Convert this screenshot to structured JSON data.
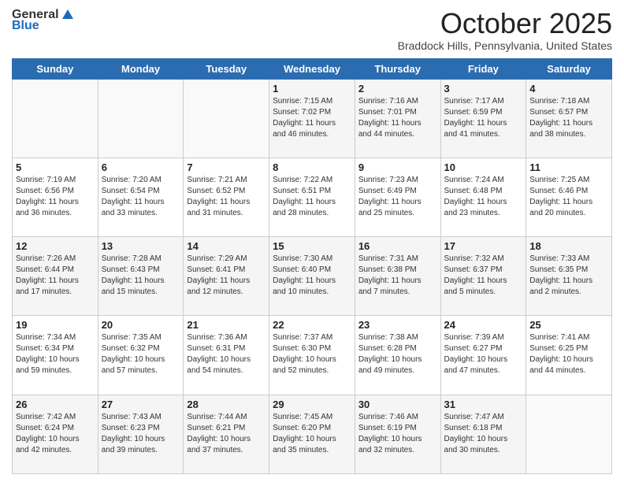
{
  "header": {
    "logo_general": "General",
    "logo_blue": "Blue",
    "month": "October 2025",
    "location": "Braddock Hills, Pennsylvania, United States"
  },
  "days_of_week": [
    "Sunday",
    "Monday",
    "Tuesday",
    "Wednesday",
    "Thursday",
    "Friday",
    "Saturday"
  ],
  "weeks": [
    [
      {
        "day": "",
        "info": ""
      },
      {
        "day": "",
        "info": ""
      },
      {
        "day": "",
        "info": ""
      },
      {
        "day": "1",
        "info": "Sunrise: 7:15 AM\nSunset: 7:02 PM\nDaylight: 11 hours\nand 46 minutes."
      },
      {
        "day": "2",
        "info": "Sunrise: 7:16 AM\nSunset: 7:01 PM\nDaylight: 11 hours\nand 44 minutes."
      },
      {
        "day": "3",
        "info": "Sunrise: 7:17 AM\nSunset: 6:59 PM\nDaylight: 11 hours\nand 41 minutes."
      },
      {
        "day": "4",
        "info": "Sunrise: 7:18 AM\nSunset: 6:57 PM\nDaylight: 11 hours\nand 38 minutes."
      }
    ],
    [
      {
        "day": "5",
        "info": "Sunrise: 7:19 AM\nSunset: 6:56 PM\nDaylight: 11 hours\nand 36 minutes."
      },
      {
        "day": "6",
        "info": "Sunrise: 7:20 AM\nSunset: 6:54 PM\nDaylight: 11 hours\nand 33 minutes."
      },
      {
        "day": "7",
        "info": "Sunrise: 7:21 AM\nSunset: 6:52 PM\nDaylight: 11 hours\nand 31 minutes."
      },
      {
        "day": "8",
        "info": "Sunrise: 7:22 AM\nSunset: 6:51 PM\nDaylight: 11 hours\nand 28 minutes."
      },
      {
        "day": "9",
        "info": "Sunrise: 7:23 AM\nSunset: 6:49 PM\nDaylight: 11 hours\nand 25 minutes."
      },
      {
        "day": "10",
        "info": "Sunrise: 7:24 AM\nSunset: 6:48 PM\nDaylight: 11 hours\nand 23 minutes."
      },
      {
        "day": "11",
        "info": "Sunrise: 7:25 AM\nSunset: 6:46 PM\nDaylight: 11 hours\nand 20 minutes."
      }
    ],
    [
      {
        "day": "12",
        "info": "Sunrise: 7:26 AM\nSunset: 6:44 PM\nDaylight: 11 hours\nand 17 minutes."
      },
      {
        "day": "13",
        "info": "Sunrise: 7:28 AM\nSunset: 6:43 PM\nDaylight: 11 hours\nand 15 minutes."
      },
      {
        "day": "14",
        "info": "Sunrise: 7:29 AM\nSunset: 6:41 PM\nDaylight: 11 hours\nand 12 minutes."
      },
      {
        "day": "15",
        "info": "Sunrise: 7:30 AM\nSunset: 6:40 PM\nDaylight: 11 hours\nand 10 minutes."
      },
      {
        "day": "16",
        "info": "Sunrise: 7:31 AM\nSunset: 6:38 PM\nDaylight: 11 hours\nand 7 minutes."
      },
      {
        "day": "17",
        "info": "Sunrise: 7:32 AM\nSunset: 6:37 PM\nDaylight: 11 hours\nand 5 minutes."
      },
      {
        "day": "18",
        "info": "Sunrise: 7:33 AM\nSunset: 6:35 PM\nDaylight: 11 hours\nand 2 minutes."
      }
    ],
    [
      {
        "day": "19",
        "info": "Sunrise: 7:34 AM\nSunset: 6:34 PM\nDaylight: 10 hours\nand 59 minutes."
      },
      {
        "day": "20",
        "info": "Sunrise: 7:35 AM\nSunset: 6:32 PM\nDaylight: 10 hours\nand 57 minutes."
      },
      {
        "day": "21",
        "info": "Sunrise: 7:36 AM\nSunset: 6:31 PM\nDaylight: 10 hours\nand 54 minutes."
      },
      {
        "day": "22",
        "info": "Sunrise: 7:37 AM\nSunset: 6:30 PM\nDaylight: 10 hours\nand 52 minutes."
      },
      {
        "day": "23",
        "info": "Sunrise: 7:38 AM\nSunset: 6:28 PM\nDaylight: 10 hours\nand 49 minutes."
      },
      {
        "day": "24",
        "info": "Sunrise: 7:39 AM\nSunset: 6:27 PM\nDaylight: 10 hours\nand 47 minutes."
      },
      {
        "day": "25",
        "info": "Sunrise: 7:41 AM\nSunset: 6:25 PM\nDaylight: 10 hours\nand 44 minutes."
      }
    ],
    [
      {
        "day": "26",
        "info": "Sunrise: 7:42 AM\nSunset: 6:24 PM\nDaylight: 10 hours\nand 42 minutes."
      },
      {
        "day": "27",
        "info": "Sunrise: 7:43 AM\nSunset: 6:23 PM\nDaylight: 10 hours\nand 39 minutes."
      },
      {
        "day": "28",
        "info": "Sunrise: 7:44 AM\nSunset: 6:21 PM\nDaylight: 10 hours\nand 37 minutes."
      },
      {
        "day": "29",
        "info": "Sunrise: 7:45 AM\nSunset: 6:20 PM\nDaylight: 10 hours\nand 35 minutes."
      },
      {
        "day": "30",
        "info": "Sunrise: 7:46 AM\nSunset: 6:19 PM\nDaylight: 10 hours\nand 32 minutes."
      },
      {
        "day": "31",
        "info": "Sunrise: 7:47 AM\nSunset: 6:18 PM\nDaylight: 10 hours\nand 30 minutes."
      },
      {
        "day": "",
        "info": ""
      }
    ]
  ]
}
